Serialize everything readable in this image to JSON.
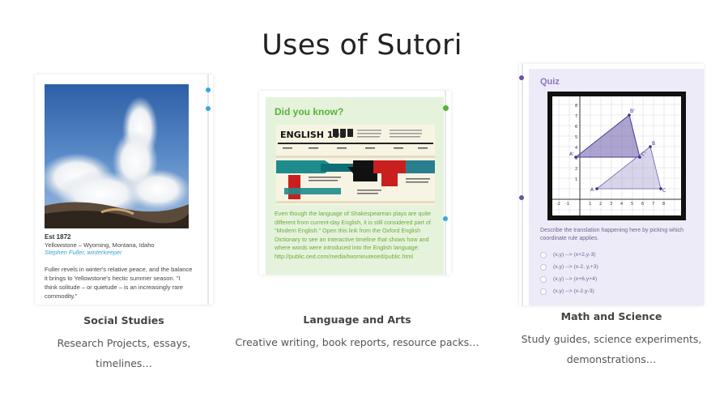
{
  "page": {
    "title": "Uses of Sutori"
  },
  "cards": [
    {
      "est": "Est 1872",
      "location": "Yellowstone – Wyoming, Montana, Idaho",
      "credit": "Stephen Fuller, winterkeeper",
      "description": "Fuller revels in winter's relative peace, and the balance it brings to Yellowstone's hectic summer season. \"I think solitude – or quietude – is an increasingly rare commodity.\"",
      "caption_title": "Social Studies",
      "caption_line1": "Research Projects, essays,",
      "caption_line2": "timelines…"
    },
    {
      "heading": "Did you know?",
      "infographic_title": "ENGLISH 101",
      "body": "Even though the language of Shakespearean plays are quite different from current-day English, it is still considered part of \"Modern English.\"  Open this link from the Oxford English Dictionary to see an interactive timeline that shows how and where words were introduced into the English language: http://public.oed.com/media/twominuteoed/public.html",
      "caption_title": "Language and Arts",
      "caption_line1": "Creative writing, book reports, resource packs…"
    },
    {
      "heading": "Quiz",
      "question": "Describe the translation happening here by picking which coordinate rule applies.",
      "options": [
        "(x,y) --> (x+2,y-3)",
        "(x,y) --> (x-2, y,+3)",
        "(x,y) --> (x+6,y+4)",
        "(x,y) --> (x-2,y-3)"
      ],
      "graph_labels": {
        "A_prime": "A'",
        "B_prime": "B'",
        "C_prime": "C'",
        "A": "A",
        "B": "B",
        "C": "C"
      },
      "caption_title": "Math and Science",
      "caption_line1": "Study guides, science experiments,",
      "caption_line2": "demonstrations…"
    }
  ],
  "colors": {
    "accent_blue": "#35a7e0",
    "accent_green": "#56b33a",
    "accent_purple": "#6b4fa8"
  }
}
